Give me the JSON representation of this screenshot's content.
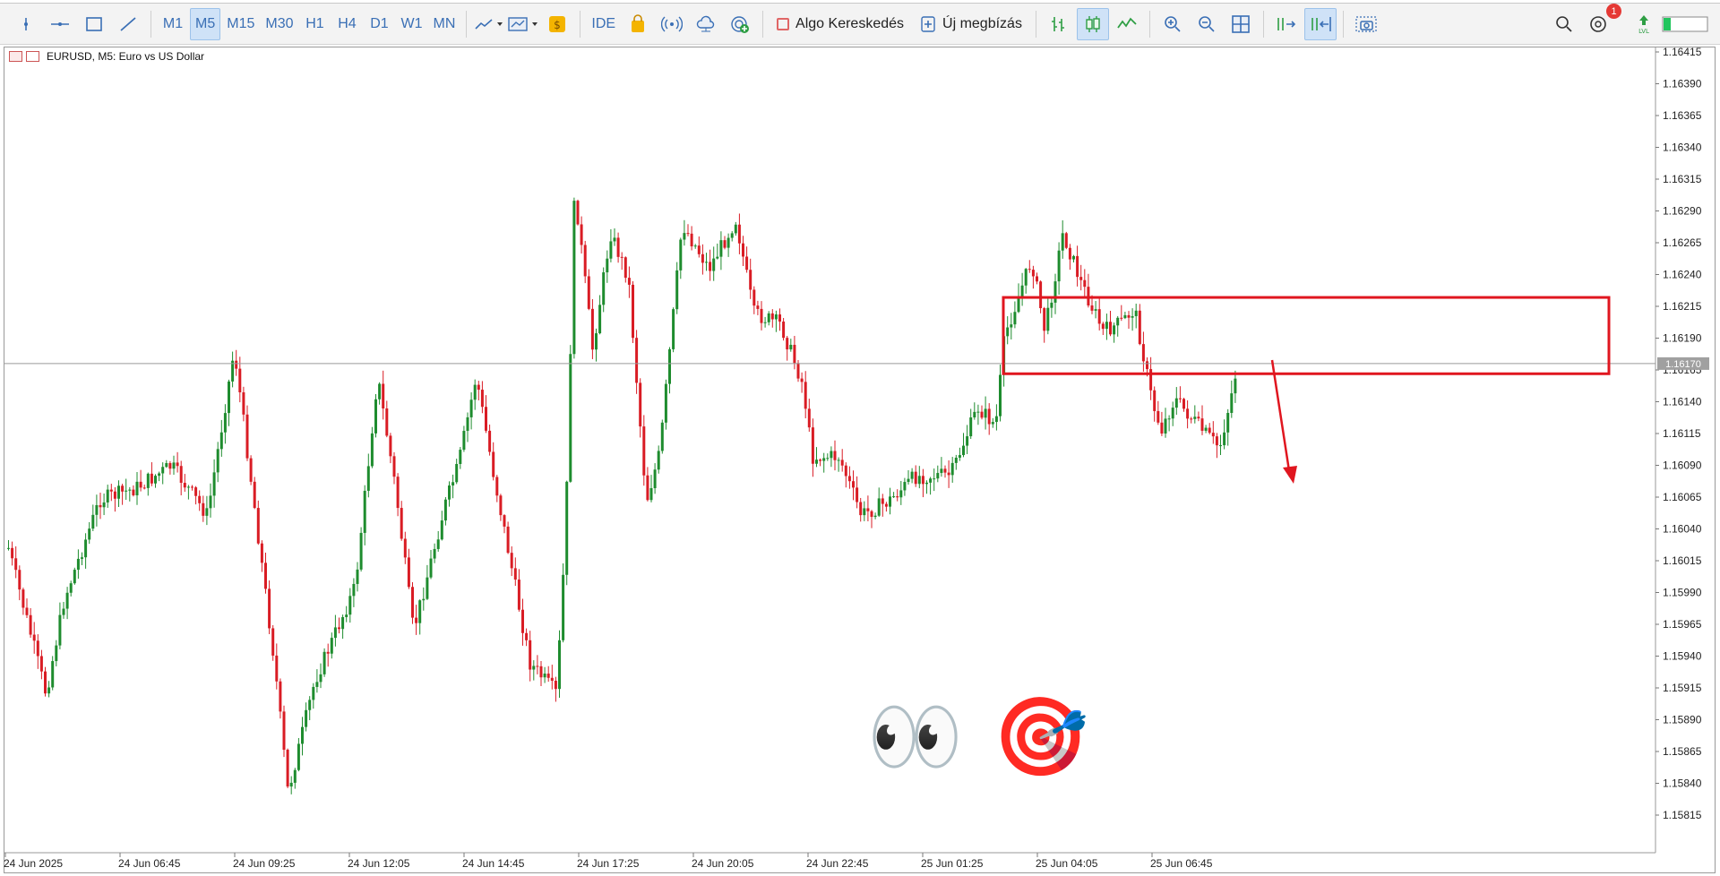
{
  "toolbar": {
    "timeframes": [
      "M1",
      "M5",
      "M15",
      "M30",
      "H1",
      "H4",
      "D1",
      "W1",
      "MN"
    ],
    "active_timeframe": "M5",
    "ide_label": "IDE",
    "algo_label": "Algo Kereskedés",
    "new_order_label": "Új megbízás",
    "notification_count": "1"
  },
  "chart": {
    "symbol_title": "EURUSD, M5:  Euro vs US Dollar",
    "current_price": "1.16170",
    "price_ticks": [
      "1.16415",
      "1.16390",
      "1.16365",
      "1.16340",
      "1.16315",
      "1.16290",
      "1.16265",
      "1.16240",
      "1.16215",
      "1.16190",
      "1.16165",
      "1.16140",
      "1.16115",
      "1.16090",
      "1.16065",
      "1.16040",
      "1.16015",
      "1.15990",
      "1.15965",
      "1.15940",
      "1.15915",
      "1.15890",
      "1.15865",
      "1.15840",
      "1.15815"
    ],
    "time_ticks": [
      "24 Jun 2025",
      "24 Jun 06:45",
      "24 Jun 09:25",
      "24 Jun 12:05",
      "24 Jun 14:45",
      "24 Jun 17:25",
      "24 Jun 20:05",
      "24 Jun 22:45",
      "25 Jun 01:25",
      "25 Jun 04:05",
      "25 Jun 06:45"
    ],
    "colors": {
      "bull": "#1e8c2e",
      "bear": "#d91c24",
      "zone": "#e0161f",
      "grid": "#ffffff",
      "price_line": "#9a9a9a",
      "tag_bg": "#a0a0a0"
    },
    "zone": {
      "price_top": 1.16222,
      "price_bottom": 1.16162
    },
    "emojis": {
      "eyes": "👀",
      "target": "🎯"
    }
  }
}
